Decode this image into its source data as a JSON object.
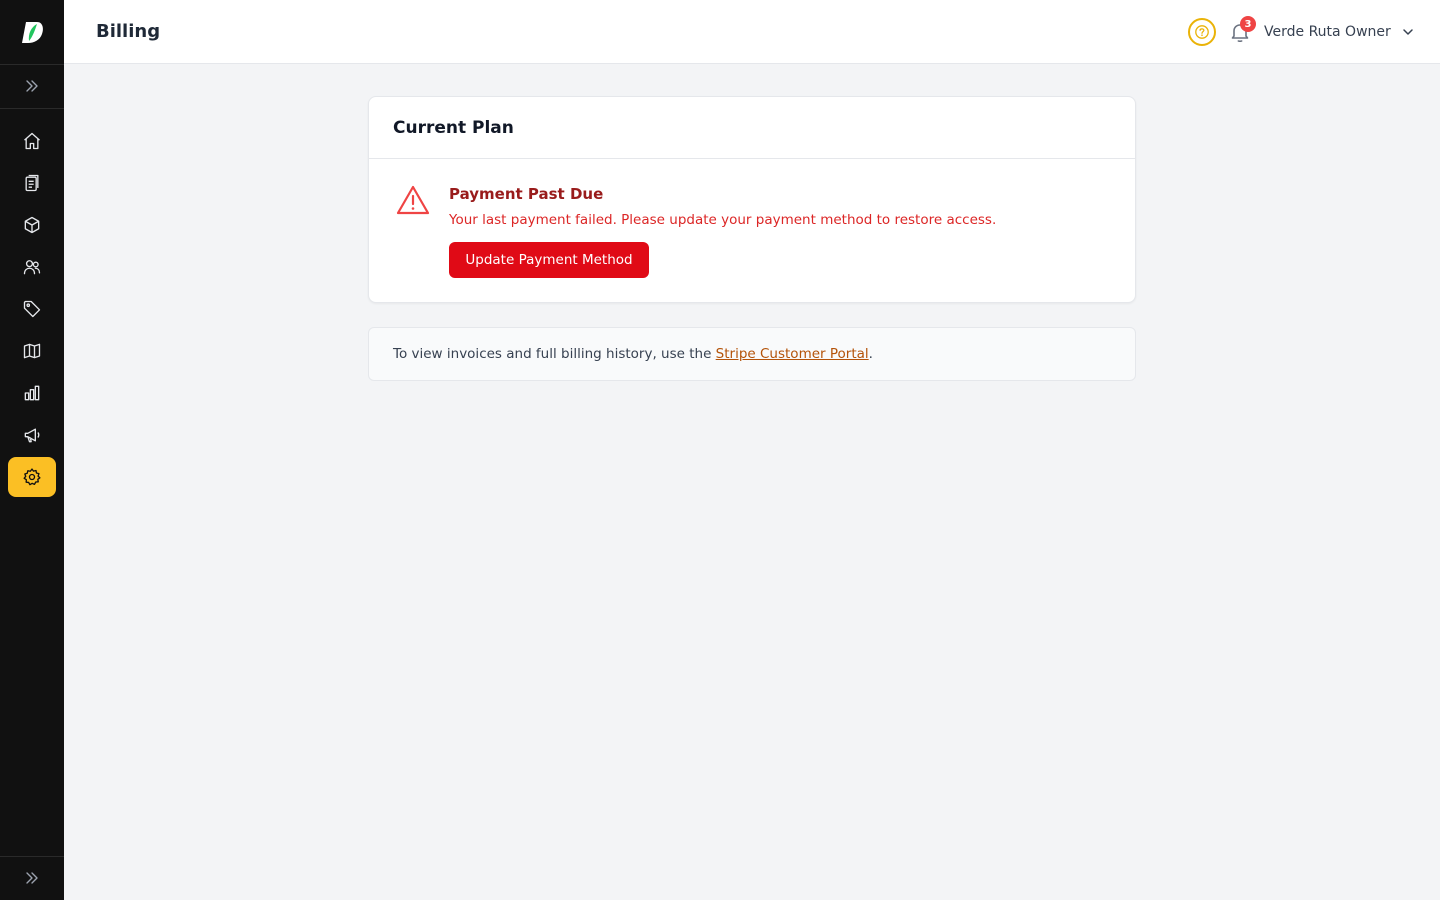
{
  "header": {
    "title": "Billing",
    "notification_count": "3",
    "user_name": "Verde Ruta Owner"
  },
  "sidebar": {
    "items": [
      {
        "icon": "home-icon",
        "active": false
      },
      {
        "icon": "clipboard-icon",
        "active": false
      },
      {
        "icon": "box-icon",
        "active": false
      },
      {
        "icon": "users-icon",
        "active": false
      },
      {
        "icon": "tag-icon",
        "active": false
      },
      {
        "icon": "map-icon",
        "active": false
      },
      {
        "icon": "bar-chart-icon",
        "active": false
      },
      {
        "icon": "megaphone-icon",
        "active": false
      },
      {
        "icon": "gear-icon",
        "active": true
      }
    ],
    "active_color": "#fbbf24"
  },
  "plan_card": {
    "title": "Current Plan",
    "alert_title": "Payment Past Due",
    "alert_message": "Your last payment failed. Please update your payment method to restore access.",
    "button_label": "Update Payment Method"
  },
  "info": {
    "text_before": "To view invoices and full billing history, use the ",
    "link_text": "Stripe Customer Portal",
    "text_after": "."
  },
  "colors": {
    "danger": "#e00a16",
    "accent": "#fbbf24",
    "link": "#b45309"
  }
}
